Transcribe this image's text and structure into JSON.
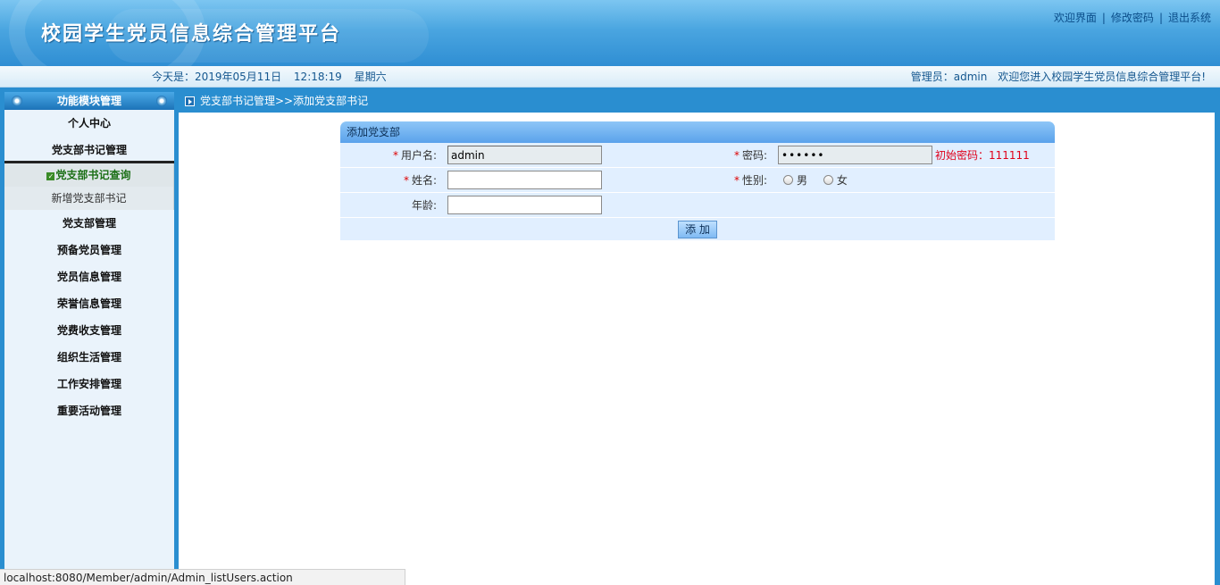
{
  "header": {
    "title": "校园学生党员信息综合管理平台",
    "links": [
      "欢迎界面",
      "修改密码",
      "退出系统"
    ],
    "separator": "|"
  },
  "infobar": {
    "date_label": "今天是：2019年05月11日",
    "time": "12:18:19",
    "weekday": "星期六",
    "admin_label": "管理员：admin",
    "welcome": "欢迎您进入校园学生党员信息综合管理平台!"
  },
  "sidebar": {
    "title": "功能模块管理",
    "items": [
      {
        "label": "个人中心"
      },
      {
        "label": "党支部书记管理",
        "active": true
      },
      {
        "label": "党支部管理"
      },
      {
        "label": "预备党员管理"
      },
      {
        "label": "党员信息管理"
      },
      {
        "label": "荣誉信息管理"
      },
      {
        "label": "党费收支管理"
      },
      {
        "label": "组织生活管理"
      },
      {
        "label": "工作安排管理"
      },
      {
        "label": "重要活动管理"
      }
    ],
    "subitems": [
      {
        "label": "党支部书记查询",
        "current": true
      },
      {
        "label": "新增党支部书记"
      }
    ]
  },
  "breadcrumb": "党支部书记管理>>添加党支部书记",
  "form": {
    "title": "添加党支部",
    "required_mark": "*",
    "username_label": "用户名:",
    "username_value": "admin",
    "password_label": "密码:",
    "password_value": "••••••",
    "password_hint": "初始密码：111111",
    "name_label": "姓名:",
    "name_value": "",
    "gender_label": "性别:",
    "gender_options": [
      "男",
      "女"
    ],
    "age_label": "年龄:",
    "age_value": "",
    "submit_label": "添 加"
  },
  "statusbar": "localhost:8080/Member/admin/Admin_listUsers.action"
}
